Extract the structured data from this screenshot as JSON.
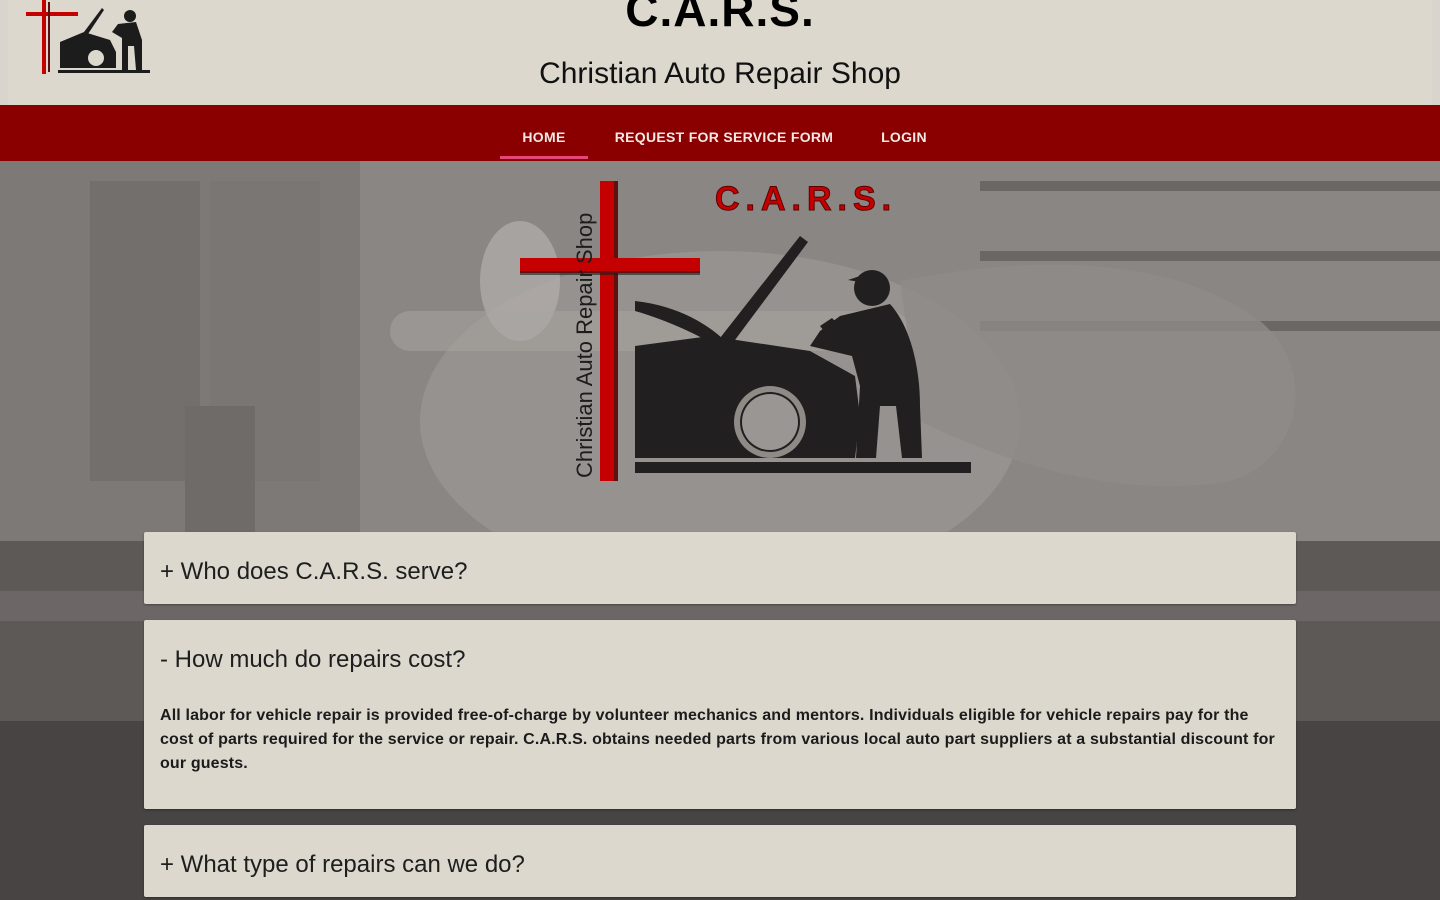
{
  "header": {
    "title": "C.A.R.S.",
    "subtitle": "Christian Auto Repair Shop",
    "logo_text": "Christian Auto Repair Shop"
  },
  "nav": {
    "items": [
      {
        "label": "HOME",
        "active": true
      },
      {
        "label": "REQUEST FOR SERVICE FORM",
        "active": false
      },
      {
        "label": "LOGIN",
        "active": false
      }
    ]
  },
  "hero": {
    "logo_title": "C.A.R.S.",
    "logo_vertical_text": "Christian Auto Repair Shop"
  },
  "faq": [
    {
      "question": "+ Who does C.A.R.S. serve?",
      "expanded": false
    },
    {
      "question": "- How much do repairs cost?",
      "expanded": true,
      "answer": "All labor for vehicle repair is provided free-of-charge by volunteer mechanics and mentors. Individuals eligible for vehicle repairs pay for the cost of parts required for the service or repair. C.A.R.S. obtains needed parts from various local auto part suppliers at a substantial discount for our guests."
    },
    {
      "question": "+ What type of repairs can we do?",
      "expanded": false
    }
  ],
  "colors": {
    "nav_background": "#8a0000",
    "nav_active_underline": "#e7467a",
    "panel_background": "#dcd8ce",
    "logo_red": "#c40000"
  }
}
